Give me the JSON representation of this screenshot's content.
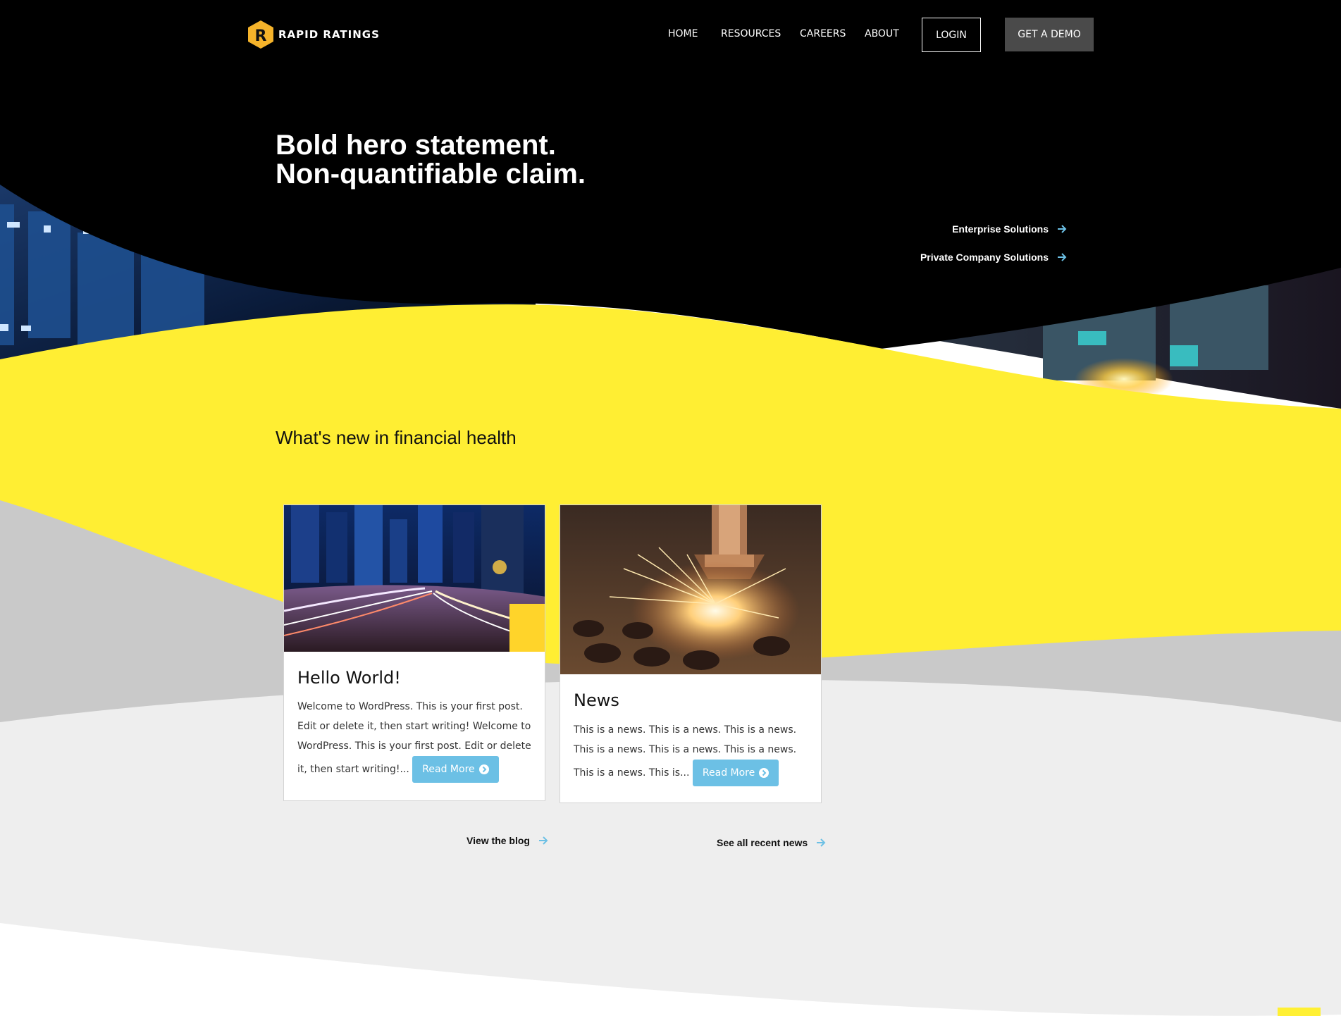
{
  "brand": {
    "name": "RAPID RATINGS",
    "logo_letter": "R"
  },
  "nav": {
    "items": [
      "HOME",
      "RESOURCES",
      "CAREERS",
      "ABOUT"
    ],
    "login_label": "LOGIN",
    "demo_label": "GET A DEMO"
  },
  "hero": {
    "title_line1": "Bold hero statement.",
    "title_line2": "Non-quantifiable claim.",
    "links": [
      "Enterprise Solutions",
      "Private Company Solutions"
    ]
  },
  "section": {
    "title": "What's new in financial health"
  },
  "cards": [
    {
      "title": "Hello World!",
      "excerpt": "Welcome to WordPress. This is your first post. Edit or delete it, then start writing! Welcome to WordPress. This is your first post. Edit or delete it, then start writing!...",
      "button": "Read More"
    },
    {
      "title": "News",
      "excerpt": "This is a news. This is a news. This is a news. This is a news. This is a news. This is a news. This is a news. This is...",
      "button": "Read More"
    }
  ],
  "footer_links": {
    "blog": "View the blog",
    "news": "See all recent news"
  },
  "colors": {
    "yellow": "#ffee33",
    "black": "#000000",
    "accent_blue": "#6cc0e5",
    "demo_button": "#4a4a4a",
    "light_gray": "#eeeeee",
    "mid_gray": "#c9c9c9"
  },
  "icons": [
    "logo-hex-icon",
    "arrow-right-icon",
    "circle-arrow-icon"
  ]
}
